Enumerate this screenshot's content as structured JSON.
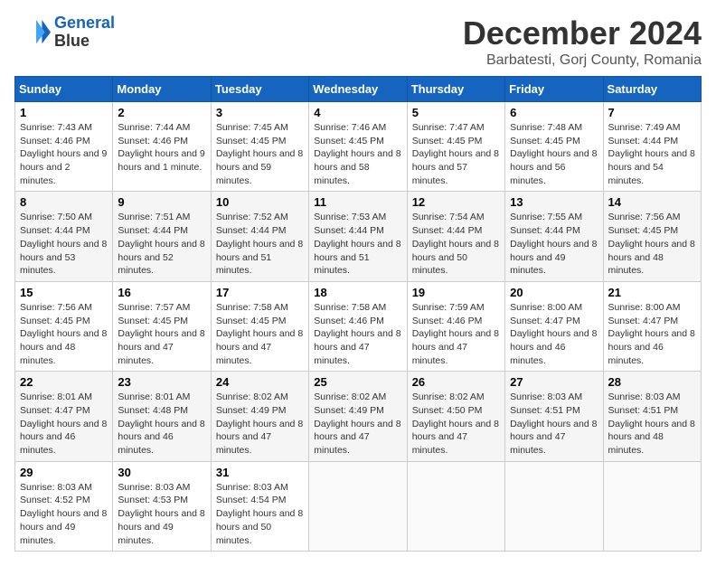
{
  "logo": {
    "line1": "General",
    "line2": "Blue"
  },
  "title": "December 2024",
  "location": "Barbatesti, Gorj County, Romania",
  "header": {
    "accent_color": "#1565c0"
  },
  "days_of_week": [
    "Sunday",
    "Monday",
    "Tuesday",
    "Wednesday",
    "Thursday",
    "Friday",
    "Saturday"
  ],
  "weeks": [
    [
      {
        "day": 1,
        "sunrise": "7:43 AM",
        "sunset": "4:46 PM",
        "daylight": "9 hours and 2 minutes."
      },
      {
        "day": 2,
        "sunrise": "7:44 AM",
        "sunset": "4:46 PM",
        "daylight": "9 hours and 1 minute."
      },
      {
        "day": 3,
        "sunrise": "7:45 AM",
        "sunset": "4:45 PM",
        "daylight": "8 hours and 59 minutes."
      },
      {
        "day": 4,
        "sunrise": "7:46 AM",
        "sunset": "4:45 PM",
        "daylight": "8 hours and 58 minutes."
      },
      {
        "day": 5,
        "sunrise": "7:47 AM",
        "sunset": "4:45 PM",
        "daylight": "8 hours and 57 minutes."
      },
      {
        "day": 6,
        "sunrise": "7:48 AM",
        "sunset": "4:45 PM",
        "daylight": "8 hours and 56 minutes."
      },
      {
        "day": 7,
        "sunrise": "7:49 AM",
        "sunset": "4:44 PM",
        "daylight": "8 hours and 54 minutes."
      }
    ],
    [
      {
        "day": 8,
        "sunrise": "7:50 AM",
        "sunset": "4:44 PM",
        "daylight": "8 hours and 53 minutes."
      },
      {
        "day": 9,
        "sunrise": "7:51 AM",
        "sunset": "4:44 PM",
        "daylight": "8 hours and 52 minutes."
      },
      {
        "day": 10,
        "sunrise": "7:52 AM",
        "sunset": "4:44 PM",
        "daylight": "8 hours and 51 minutes."
      },
      {
        "day": 11,
        "sunrise": "7:53 AM",
        "sunset": "4:44 PM",
        "daylight": "8 hours and 51 minutes."
      },
      {
        "day": 12,
        "sunrise": "7:54 AM",
        "sunset": "4:44 PM",
        "daylight": "8 hours and 50 minutes."
      },
      {
        "day": 13,
        "sunrise": "7:55 AM",
        "sunset": "4:44 PM",
        "daylight": "8 hours and 49 minutes."
      },
      {
        "day": 14,
        "sunrise": "7:56 AM",
        "sunset": "4:45 PM",
        "daylight": "8 hours and 48 minutes."
      }
    ],
    [
      {
        "day": 15,
        "sunrise": "7:56 AM",
        "sunset": "4:45 PM",
        "daylight": "8 hours and 48 minutes."
      },
      {
        "day": 16,
        "sunrise": "7:57 AM",
        "sunset": "4:45 PM",
        "daylight": "8 hours and 47 minutes."
      },
      {
        "day": 17,
        "sunrise": "7:58 AM",
        "sunset": "4:45 PM",
        "daylight": "8 hours and 47 minutes."
      },
      {
        "day": 18,
        "sunrise": "7:58 AM",
        "sunset": "4:46 PM",
        "daylight": "8 hours and 47 minutes."
      },
      {
        "day": 19,
        "sunrise": "7:59 AM",
        "sunset": "4:46 PM",
        "daylight": "8 hours and 47 minutes."
      },
      {
        "day": 20,
        "sunrise": "8:00 AM",
        "sunset": "4:47 PM",
        "daylight": "8 hours and 46 minutes."
      },
      {
        "day": 21,
        "sunrise": "8:00 AM",
        "sunset": "4:47 PM",
        "daylight": "8 hours and 46 minutes."
      }
    ],
    [
      {
        "day": 22,
        "sunrise": "8:01 AM",
        "sunset": "4:47 PM",
        "daylight": "8 hours and 46 minutes."
      },
      {
        "day": 23,
        "sunrise": "8:01 AM",
        "sunset": "4:48 PM",
        "daylight": "8 hours and 46 minutes."
      },
      {
        "day": 24,
        "sunrise": "8:02 AM",
        "sunset": "4:49 PM",
        "daylight": "8 hours and 47 minutes."
      },
      {
        "day": 25,
        "sunrise": "8:02 AM",
        "sunset": "4:49 PM",
        "daylight": "8 hours and 47 minutes."
      },
      {
        "day": 26,
        "sunrise": "8:02 AM",
        "sunset": "4:50 PM",
        "daylight": "8 hours and 47 minutes."
      },
      {
        "day": 27,
        "sunrise": "8:03 AM",
        "sunset": "4:51 PM",
        "daylight": "8 hours and 47 minutes."
      },
      {
        "day": 28,
        "sunrise": "8:03 AM",
        "sunset": "4:51 PM",
        "daylight": "8 hours and 48 minutes."
      }
    ],
    [
      {
        "day": 29,
        "sunrise": "8:03 AM",
        "sunset": "4:52 PM",
        "daylight": "8 hours and 49 minutes."
      },
      {
        "day": 30,
        "sunrise": "8:03 AM",
        "sunset": "4:53 PM",
        "daylight": "8 hours and 49 minutes."
      },
      {
        "day": 31,
        "sunrise": "8:03 AM",
        "sunset": "4:54 PM",
        "daylight": "8 hours and 50 minutes."
      },
      null,
      null,
      null,
      null
    ]
  ]
}
